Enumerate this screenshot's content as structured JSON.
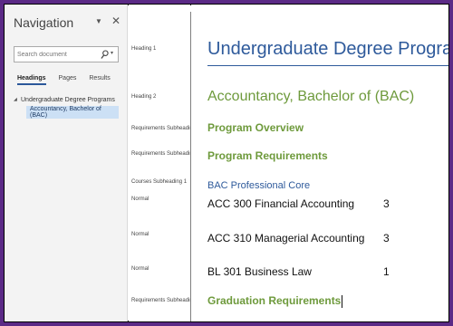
{
  "navigation": {
    "title": "Navigation",
    "search_placeholder": "Search document",
    "tabs": [
      {
        "label": "Headings",
        "active": true
      },
      {
        "label": "Pages",
        "active": false
      },
      {
        "label": "Results",
        "active": false
      }
    ],
    "tree": [
      {
        "label": "Undergraduate Degree Programs",
        "expanded": true
      },
      {
        "label": "Accountancy, Bachelor of (BAC)",
        "selected": true
      }
    ]
  },
  "style_labels": [
    "Heading 1",
    "Heading 2",
    "Requirements Subheading",
    "Requirements Subheading",
    "Courses Subheading 1",
    "Normal",
    "Normal",
    "Normal",
    "Requirements Subheading"
  ],
  "document": {
    "heading1": "Undergraduate Degree Programs",
    "heading2": "Accountancy, Bachelor of (BAC)",
    "program_overview": "Program Overview",
    "program_requirements": "Program Requirements",
    "courses_subheading": "BAC Professional Core",
    "courses": [
      {
        "name": "ACC 300 Financial Accounting",
        "credits": "3"
      },
      {
        "name": "ACC 310 Managerial Accounting",
        "credits": "3"
      },
      {
        "name": "BL 301 Business Law",
        "credits": "1"
      }
    ],
    "graduation_requirements": "Graduation Requirements"
  },
  "colors": {
    "frame": "#5b2a86",
    "heading1": "#2e5a9b",
    "heading2": "#6e9a3c",
    "selection": "#cce0f5"
  }
}
